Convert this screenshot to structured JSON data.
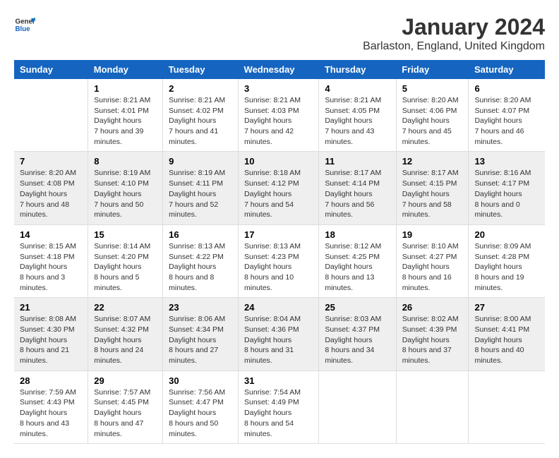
{
  "logo": {
    "general": "General",
    "blue": "Blue"
  },
  "title": "January 2024",
  "subtitle": "Barlaston, England, United Kingdom",
  "header_color": "#1565c0",
  "days_of_week": [
    "Sunday",
    "Monday",
    "Tuesday",
    "Wednesday",
    "Thursday",
    "Friday",
    "Saturday"
  ],
  "weeks": [
    [
      {
        "day": "",
        "sunrise": "",
        "sunset": "",
        "daylight": ""
      },
      {
        "day": "1",
        "sunrise": "Sunrise: 8:21 AM",
        "sunset": "Sunset: 4:01 PM",
        "daylight": "Daylight: 7 hours and 39 minutes."
      },
      {
        "day": "2",
        "sunrise": "Sunrise: 8:21 AM",
        "sunset": "Sunset: 4:02 PM",
        "daylight": "Daylight: 7 hours and 41 minutes."
      },
      {
        "day": "3",
        "sunrise": "Sunrise: 8:21 AM",
        "sunset": "Sunset: 4:03 PM",
        "daylight": "Daylight: 7 hours and 42 minutes."
      },
      {
        "day": "4",
        "sunrise": "Sunrise: 8:21 AM",
        "sunset": "Sunset: 4:05 PM",
        "daylight": "Daylight: 7 hours and 43 minutes."
      },
      {
        "day": "5",
        "sunrise": "Sunrise: 8:20 AM",
        "sunset": "Sunset: 4:06 PM",
        "daylight": "Daylight: 7 hours and 45 minutes."
      },
      {
        "day": "6",
        "sunrise": "Sunrise: 8:20 AM",
        "sunset": "Sunset: 4:07 PM",
        "daylight": "Daylight: 7 hours and 46 minutes."
      }
    ],
    [
      {
        "day": "7",
        "sunrise": "Sunrise: 8:20 AM",
        "sunset": "Sunset: 4:08 PM",
        "daylight": "Daylight: 7 hours and 48 minutes."
      },
      {
        "day": "8",
        "sunrise": "Sunrise: 8:19 AM",
        "sunset": "Sunset: 4:10 PM",
        "daylight": "Daylight: 7 hours and 50 minutes."
      },
      {
        "day": "9",
        "sunrise": "Sunrise: 8:19 AM",
        "sunset": "Sunset: 4:11 PM",
        "daylight": "Daylight: 7 hours and 52 minutes."
      },
      {
        "day": "10",
        "sunrise": "Sunrise: 8:18 AM",
        "sunset": "Sunset: 4:12 PM",
        "daylight": "Daylight: 7 hours and 54 minutes."
      },
      {
        "day": "11",
        "sunrise": "Sunrise: 8:17 AM",
        "sunset": "Sunset: 4:14 PM",
        "daylight": "Daylight: 7 hours and 56 minutes."
      },
      {
        "day": "12",
        "sunrise": "Sunrise: 8:17 AM",
        "sunset": "Sunset: 4:15 PM",
        "daylight": "Daylight: 7 hours and 58 minutes."
      },
      {
        "day": "13",
        "sunrise": "Sunrise: 8:16 AM",
        "sunset": "Sunset: 4:17 PM",
        "daylight": "Daylight: 8 hours and 0 minutes."
      }
    ],
    [
      {
        "day": "14",
        "sunrise": "Sunrise: 8:15 AM",
        "sunset": "Sunset: 4:18 PM",
        "daylight": "Daylight: 8 hours and 3 minutes."
      },
      {
        "day": "15",
        "sunrise": "Sunrise: 8:14 AM",
        "sunset": "Sunset: 4:20 PM",
        "daylight": "Daylight: 8 hours and 5 minutes."
      },
      {
        "day": "16",
        "sunrise": "Sunrise: 8:13 AM",
        "sunset": "Sunset: 4:22 PM",
        "daylight": "Daylight: 8 hours and 8 minutes."
      },
      {
        "day": "17",
        "sunrise": "Sunrise: 8:13 AM",
        "sunset": "Sunset: 4:23 PM",
        "daylight": "Daylight: 8 hours and 10 minutes."
      },
      {
        "day": "18",
        "sunrise": "Sunrise: 8:12 AM",
        "sunset": "Sunset: 4:25 PM",
        "daylight": "Daylight: 8 hours and 13 minutes."
      },
      {
        "day": "19",
        "sunrise": "Sunrise: 8:10 AM",
        "sunset": "Sunset: 4:27 PM",
        "daylight": "Daylight: 8 hours and 16 minutes."
      },
      {
        "day": "20",
        "sunrise": "Sunrise: 8:09 AM",
        "sunset": "Sunset: 4:28 PM",
        "daylight": "Daylight: 8 hours and 19 minutes."
      }
    ],
    [
      {
        "day": "21",
        "sunrise": "Sunrise: 8:08 AM",
        "sunset": "Sunset: 4:30 PM",
        "daylight": "Daylight: 8 hours and 21 minutes."
      },
      {
        "day": "22",
        "sunrise": "Sunrise: 8:07 AM",
        "sunset": "Sunset: 4:32 PM",
        "daylight": "Daylight: 8 hours and 24 minutes."
      },
      {
        "day": "23",
        "sunrise": "Sunrise: 8:06 AM",
        "sunset": "Sunset: 4:34 PM",
        "daylight": "Daylight: 8 hours and 27 minutes."
      },
      {
        "day": "24",
        "sunrise": "Sunrise: 8:04 AM",
        "sunset": "Sunset: 4:36 PM",
        "daylight": "Daylight: 8 hours and 31 minutes."
      },
      {
        "day": "25",
        "sunrise": "Sunrise: 8:03 AM",
        "sunset": "Sunset: 4:37 PM",
        "daylight": "Daylight: 8 hours and 34 minutes."
      },
      {
        "day": "26",
        "sunrise": "Sunrise: 8:02 AM",
        "sunset": "Sunset: 4:39 PM",
        "daylight": "Daylight: 8 hours and 37 minutes."
      },
      {
        "day": "27",
        "sunrise": "Sunrise: 8:00 AM",
        "sunset": "Sunset: 4:41 PM",
        "daylight": "Daylight: 8 hours and 40 minutes."
      }
    ],
    [
      {
        "day": "28",
        "sunrise": "Sunrise: 7:59 AM",
        "sunset": "Sunset: 4:43 PM",
        "daylight": "Daylight: 8 hours and 43 minutes."
      },
      {
        "day": "29",
        "sunrise": "Sunrise: 7:57 AM",
        "sunset": "Sunset: 4:45 PM",
        "daylight": "Daylight: 8 hours and 47 minutes."
      },
      {
        "day": "30",
        "sunrise": "Sunrise: 7:56 AM",
        "sunset": "Sunset: 4:47 PM",
        "daylight": "Daylight: 8 hours and 50 minutes."
      },
      {
        "day": "31",
        "sunrise": "Sunrise: 7:54 AM",
        "sunset": "Sunset: 4:49 PM",
        "daylight": "Daylight: 8 hours and 54 minutes."
      },
      {
        "day": "",
        "sunrise": "",
        "sunset": "",
        "daylight": ""
      },
      {
        "day": "",
        "sunrise": "",
        "sunset": "",
        "daylight": ""
      },
      {
        "day": "",
        "sunrise": "",
        "sunset": "",
        "daylight": ""
      }
    ]
  ]
}
